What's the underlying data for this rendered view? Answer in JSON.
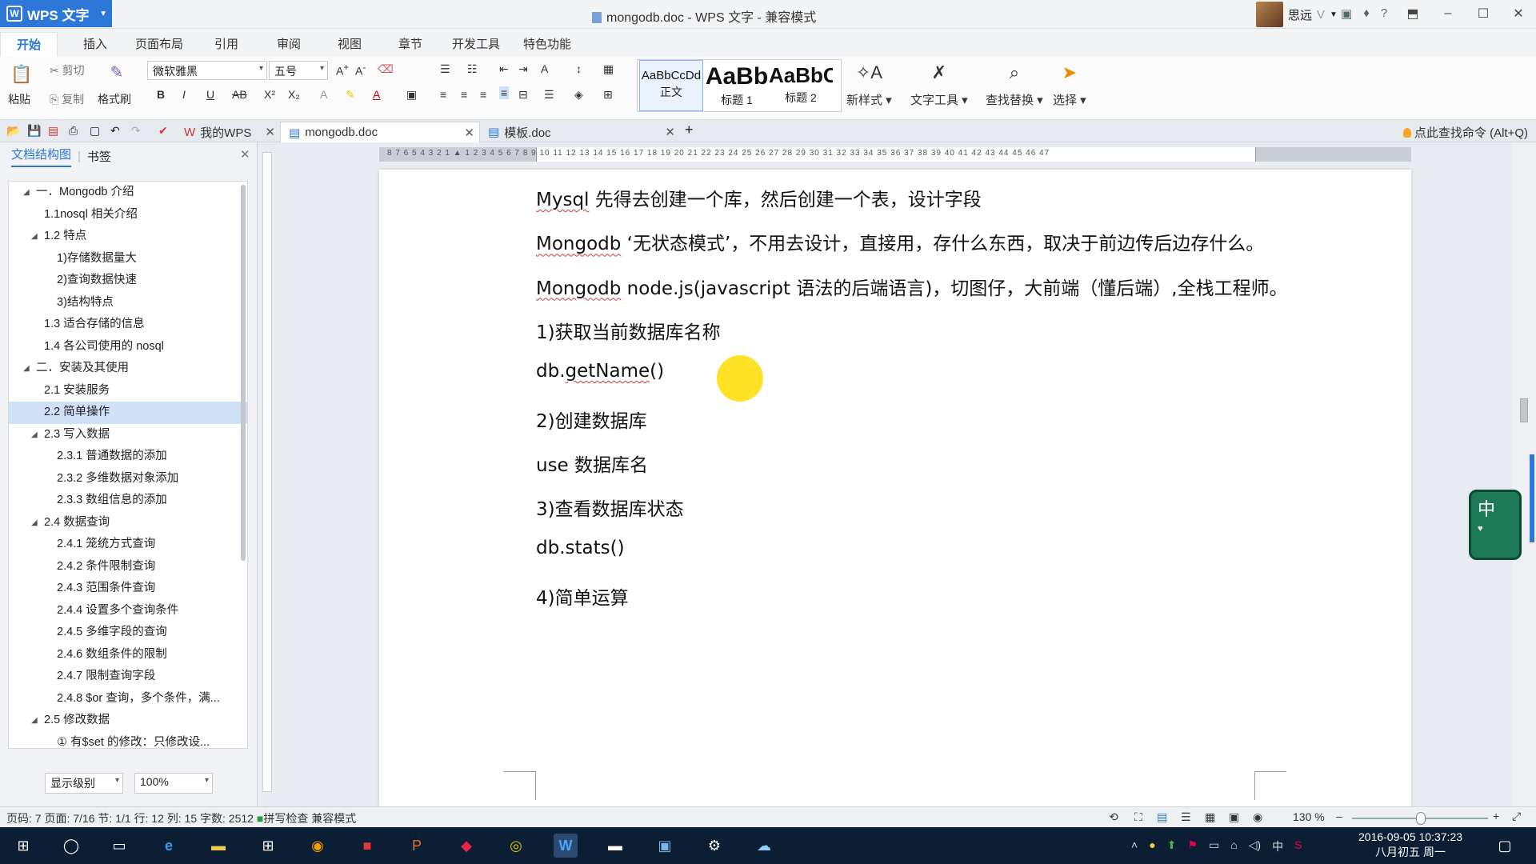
{
  "titlebar": {
    "app_name": "WPS 文字",
    "doc_title": "mongodb.doc - WPS 文字 - 兼容模式",
    "user_name": "思远"
  },
  "ribbon_tabs": [
    "开始",
    "插入",
    "页面布局",
    "引用",
    "审阅",
    "视图",
    "章节",
    "开发工具",
    "特色功能"
  ],
  "ribbon": {
    "paste": "粘贴",
    "cut": "剪切",
    "copy": "复制",
    "format_painter": "格式刷",
    "font_name": "微软雅黑",
    "font_size": "五号",
    "styles": [
      {
        "preview": "AaBbCcDd",
        "name": "正文"
      },
      {
        "preview": "AaBb",
        "name": "标题 1"
      },
      {
        "preview": "AaBbC",
        "name": "标题 2"
      }
    ],
    "new_style": "新样式",
    "text_tools": "文字工具",
    "find_replace": "查找替换",
    "select": "选择"
  },
  "doc_tabs": {
    "my_wps": "我的WPS",
    "active": "mongodb.doc",
    "other": "模板.doc",
    "find_command": "点此查找命令 (Alt+Q)"
  },
  "nav": {
    "tab_outline": "文档结构图",
    "tab_bookmark": "书签",
    "items": [
      {
        "label": "一．Mongodb 介绍",
        "level": 0,
        "arrow": "◢"
      },
      {
        "label": "1.1nosql 相关介绍",
        "level": 1
      },
      {
        "label": "1.2 特点",
        "level": 1,
        "arrow": "◢"
      },
      {
        "label": "1)存储数据量大",
        "level": 2
      },
      {
        "label": "2)查询数据快速",
        "level": 2
      },
      {
        "label": "3)结构特点",
        "level": 2
      },
      {
        "label": "1.3 适合存储的信息",
        "level": 1
      },
      {
        "label": "1.4 各公司使用的 nosql",
        "level": 1
      },
      {
        "label": "二．安装及其使用",
        "level": 0,
        "arrow": "◢"
      },
      {
        "label": "2.1 安装服务",
        "level": 1
      },
      {
        "label": "2.2 简单操作",
        "level": 1,
        "selected": true
      },
      {
        "label": "2.3 写入数据",
        "level": 1,
        "arrow": "◢"
      },
      {
        "label": "2.3.1 普通数据的添加",
        "level": 2
      },
      {
        "label": "2.3.2 多维数据对象添加",
        "level": 2
      },
      {
        "label": "2.3.3 数组信息的添加",
        "level": 2
      },
      {
        "label": "2.4 数据查询",
        "level": 1,
        "arrow": "◢"
      },
      {
        "label": "2.4.1 笼统方式查询",
        "level": 2
      },
      {
        "label": "2.4.2 条件限制查询",
        "level": 2
      },
      {
        "label": "2.4.3 范围条件查询",
        "level": 2
      },
      {
        "label": "2.4.4 设置多个查询条件",
        "level": 2
      },
      {
        "label": "2.4.5 多维字段的查询",
        "level": 2
      },
      {
        "label": "2.4.6 数组条件的限制",
        "level": 2
      },
      {
        "label": "2.4.7 限制查询字段",
        "level": 2
      },
      {
        "label": "2.4.8 $or 查询，多个条件，满...",
        "level": 2
      },
      {
        "label": "2.5 修改数据",
        "level": 1,
        "arrow": "◢"
      },
      {
        "label": "① 有$set 的修改：只修改设...",
        "level": 2
      }
    ],
    "display_level": "显示级别",
    "zoom": "100%"
  },
  "document": {
    "paragraphs": [
      {
        "plain": "",
        "spell": "Mysql",
        "rest": "  先得去创建一个库，然后创建一个表，设计字段"
      },
      {
        "plain": "",
        "spell": "Mongodb",
        "rest": "   ‘无状态模式’，不用去设计，直接用，存什么东西，取决于前边传后边存什么。"
      },
      {
        "plain": "",
        "spell": "Mongodb",
        "rest": " node.js(javascript 语法的后端语言)，切图仔，大前端（懂后端）,全栈工程师。"
      },
      {
        "plain": "1)获取当前数据库名称",
        "spell": "",
        "rest": ""
      },
      {
        "plain": "db.",
        "spell": "getName",
        "rest": "()"
      },
      {
        "plain": "2)创建数据库",
        "spell": "",
        "rest": ""
      },
      {
        "plain": "use  数据库名",
        "spell": "",
        "rest": ""
      },
      {
        "plain": "3)查看数据库状态",
        "spell": "",
        "rest": ""
      },
      {
        "plain": "db.stats()",
        "spell": "",
        "rest": ""
      },
      {
        "plain": "4)简单运算",
        "spell": "",
        "rest": ""
      }
    ]
  },
  "ruler_numbers": "8  7  6  5  4  3  2  1  ▲  1  2  3  4  5  6  7  8  9  10  11  12  13  14  15  16  17  18  19  20  21  22  23  24  25  26  27  28  29  30  31  32  33  34  35  36  37  38  39  40  41  42  43  44  45  46  47",
  "statusbar": {
    "page_num": "页码: 7",
    "page": "页面: 7/16",
    "section": "节: 1/1",
    "line": "行: 12",
    "col": "列: 15",
    "words": "字数: 2512",
    "spell": "拼写检查",
    "mode": "兼容模式",
    "zoom": "130 %"
  },
  "taskbar": {
    "date": "2016-09-05",
    "time": "10:37:23",
    "lunar": "八月初五 周一",
    "ime": "中"
  }
}
